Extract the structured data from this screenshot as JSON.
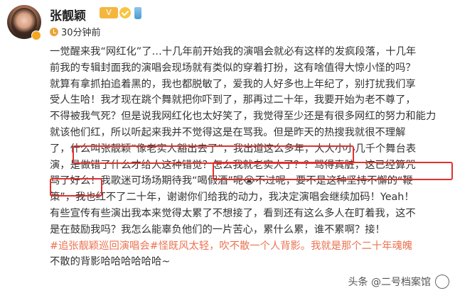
{
  "user": {
    "name": "张靓颖",
    "level_badge": "V",
    "time": "30分钟前",
    "avatar_icon": "avatar-photo",
    "verified_icon": "verified-badge-icon"
  },
  "post": {
    "lines": [
      "一觉醒来我“网红化”了…十几年前开始我的演唱会就必有这样的发疯段落，十几年",
      "前我的专辑封面我的演唱会现场就有类似的穿着打扮，这有啥值得大惊小怪的吗？",
      "就算有拿抓拍追着黑的，我也都脱敏了，爱我的人好多也上年纪了，别打扰我们享",
      "受人生哈！我才现在跳个舞就把你吓到了，那再过二十年，我要开始为老不尊了，",
      "不得被我气死？但是说我网红化也太好笑了，我觉得至少还是有很多网红的努力和能力",
      "就该他们红，所以听起来我并不觉得这是在骂我。但是昨天的热搜我就很不理解",
      "了，什么叫张靓颖“像老实人豁出去了”，我出道这么多年，大大小小几千个舞台表",
      "演，是做错了什么才给人这种错觉？怎么我就老实人了？？骂得真脏，这已经算咒",
      "骂了好么！我歌迷可场场期待我“喝假酒”呢😭不过呢，要不是这种坚持不懈的“鞭",
      "策”，我也红不了二十年，谢谢你们给我的动力，我决定演唱会继续加码！Yeah！",
      "有些宣传有些演出我本来觉得太累了不想接了，看到还有这么多人在盯着我，这不",
      "是在鼓励我吗？我怎么能辜负他们的一片苦心，累什么累，谁不累啊？接！",
      "#追张靓颖巡回演唱会#怪既风太轻，吹不散一个人背影。我就是那个二十年魂魄",
      "不散的背影哈哈哈哈哈哈~"
    ]
  },
  "watermark": {
    "text": "头条 @二号档案馆",
    "icon": "archive-logo-icon"
  },
  "colors": {
    "hashtag": "#eb7350",
    "highlight_box": "#e0312c",
    "badge": "#f4b63d"
  }
}
